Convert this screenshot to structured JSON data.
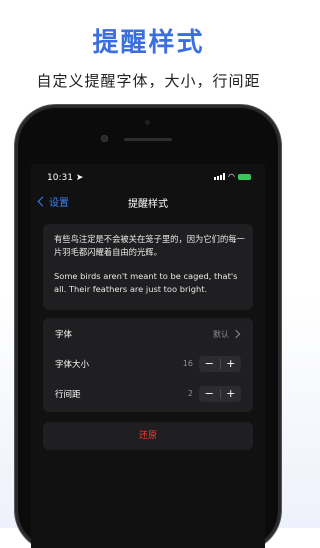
{
  "hero": {
    "title": "提醒样式",
    "subtitle": "自定义提醒字体，大小，行间距"
  },
  "status_bar": {
    "time": "10:31",
    "location_icon": "location-arrow-icon",
    "wifi_icon": "wifi-icon",
    "battery_icon": "battery-charging-icon",
    "battery_color": "#35c759"
  },
  "nav": {
    "back_label": "设置",
    "title": "提醒样式",
    "accent": "#3a82f7"
  },
  "preview": {
    "zh_text": "有些鸟注定是不会被关在笼子里的，因为它们的每一片羽毛都闪耀着自由的光辉。",
    "en_text": "Some birds aren't meant to be caged, that's all. Their feathers are just too bright."
  },
  "settings": {
    "font": {
      "label": "字体",
      "value": "默认"
    },
    "font_size": {
      "label": "字体大小",
      "value": "16",
      "minus": "−",
      "plus": "+"
    },
    "line_spacing": {
      "label": "行间距",
      "value": "2",
      "minus": "−",
      "plus": "+"
    }
  },
  "restore": {
    "label": "还原",
    "color": "#ff3b30"
  }
}
